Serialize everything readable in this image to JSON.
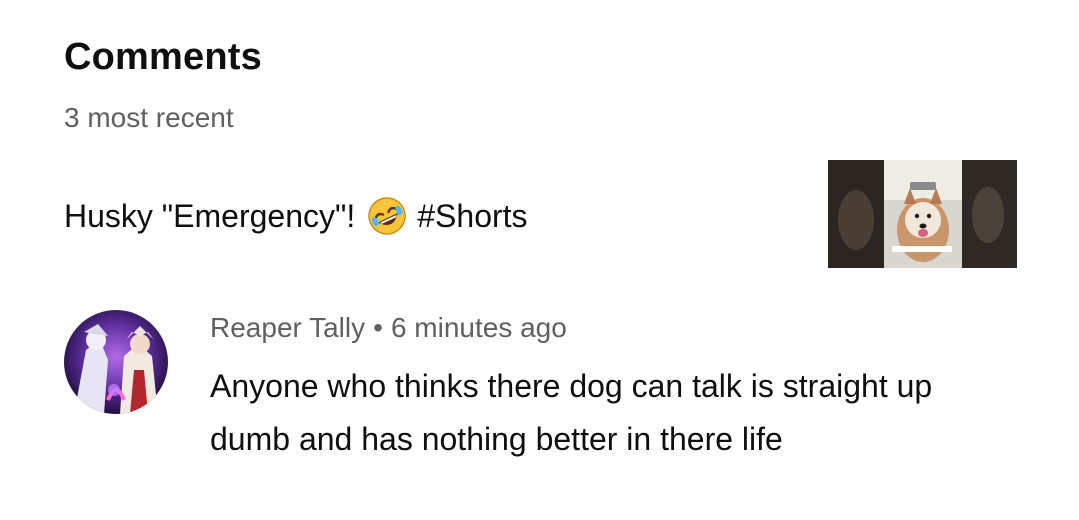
{
  "header": {
    "title": "Comments",
    "subtitle": "3 most recent"
  },
  "video": {
    "title_before_emoji": "Husky \"Emergency\"!",
    "emoji_icon": "rolling-on-floor-laughing-emoji",
    "title_after_emoji": "#Shorts",
    "thumbnail_icon": "husky-video-thumbnail"
  },
  "comment": {
    "author": "Reaper Tally",
    "separator": "•",
    "timestamp": "6 minutes ago",
    "text": "Anyone who thinks there dog can talk is straight up dumb and has nothing better in there life",
    "avatar_icon": "anime-character-avatar"
  }
}
